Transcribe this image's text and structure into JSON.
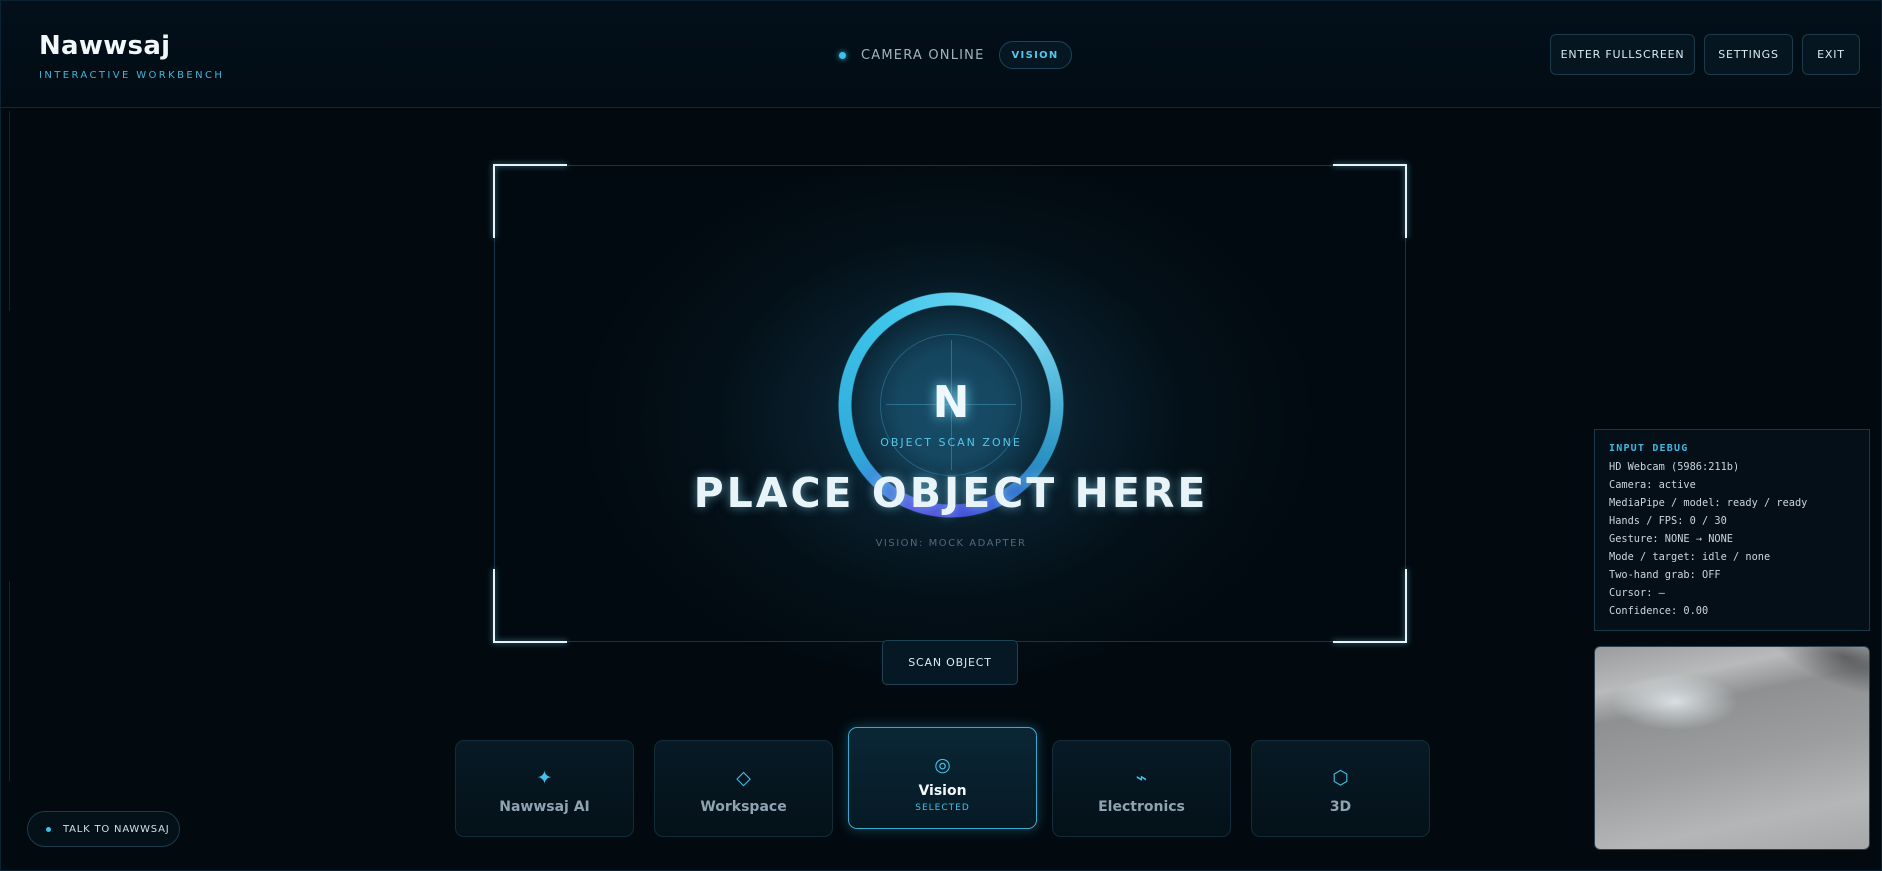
{
  "app": {
    "title": "Nawwsaj",
    "subtitle": "INTERACTIVE WORKBENCH"
  },
  "status": {
    "camera_text": "CAMERA ONLINE",
    "mode_pill": "VISION"
  },
  "header_buttons": {
    "fullscreen": "ENTER FULLSCREEN",
    "settings": "SETTINGS",
    "exit": "EXIT"
  },
  "scan": {
    "ring_letter": "N",
    "ring_caption": "OBJECT SCAN ZONE",
    "prompt": "PLACE OBJECT HERE",
    "adapter": "VISION: MOCK ADAPTER",
    "scan_button": "SCAN OBJECT"
  },
  "modules": [
    {
      "label": "Nawwsaj AI",
      "icon": "sparkle-icon",
      "glyph": "✦"
    },
    {
      "label": "Workspace",
      "icon": "diamond-icon",
      "glyph": "◇"
    },
    {
      "label": "Vision",
      "icon": "target-icon",
      "glyph": "◎",
      "selected": true,
      "sub": "SELECTED"
    },
    {
      "label": "Electronics",
      "icon": "wave-icon",
      "glyph": "⌁"
    },
    {
      "label": "3D",
      "icon": "hexagon-icon",
      "glyph": "⬡"
    }
  ],
  "talk_button": "TALK TO NAWWSAJ",
  "debug": {
    "title": "INPUT DEBUG",
    "lines": [
      "HD Webcam (5986:211b)",
      "Camera: active",
      "MediaPipe / model: ready / ready",
      "Hands / FPS: 0 / 30",
      "Gesture: NONE → NONE",
      "Mode / target: idle / none",
      "Two-hand grab: OFF",
      "Cursor: —",
      "Confidence: 0.00"
    ]
  },
  "colors": {
    "accent": "#3cc2e8",
    "background": "#020a10",
    "selected_border": "#3aa9cf"
  }
}
